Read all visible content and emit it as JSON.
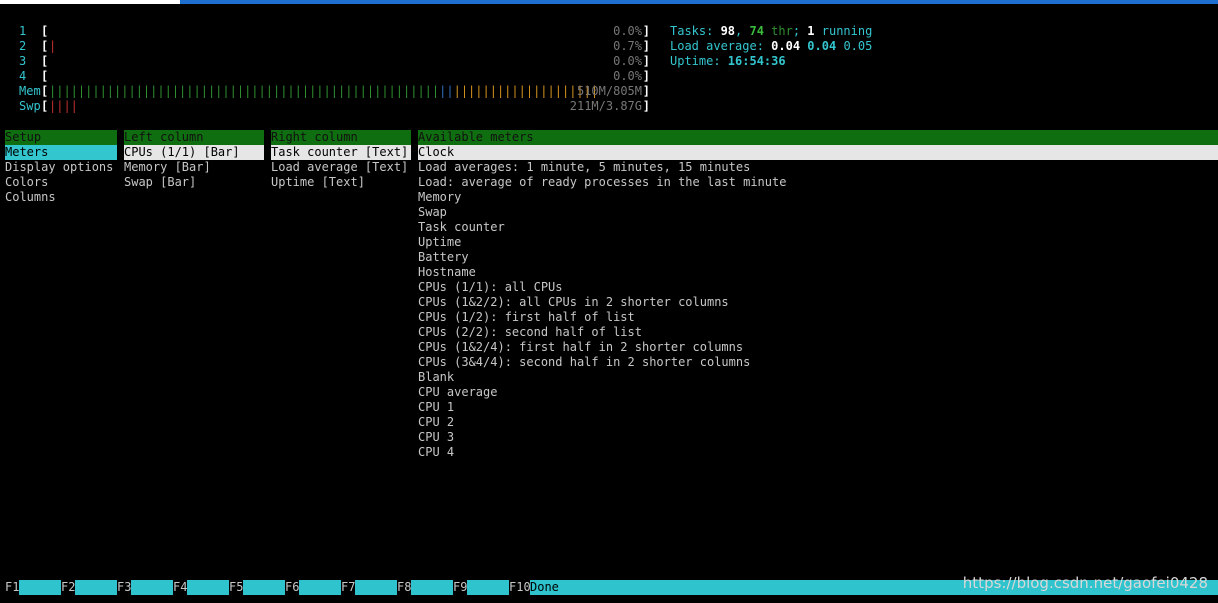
{
  "cpus": [
    {
      "num": "1",
      "bars": "",
      "value": "0.0%"
    },
    {
      "num": "2",
      "bars": "|",
      "value": "0.7%"
    },
    {
      "num": "3",
      "bars": "",
      "value": "0.0%"
    },
    {
      "num": "4",
      "bars": "",
      "value": "0.0%"
    }
  ],
  "mem": {
    "label": "Mem",
    "value": "510M/805M"
  },
  "swp": {
    "label": "Swp",
    "value": "211M/3.87G"
  },
  "tasks": {
    "label": "Tasks: ",
    "count": "98",
    "sep": ", ",
    "thr_count": "74",
    "thr": " thr",
    "sep2": "; ",
    "running_count": "1",
    "running": " running"
  },
  "load": {
    "label": "Load average: ",
    "l1": "0.04",
    "l5": "0.04",
    "l15": "0.05"
  },
  "uptime": {
    "label": "Uptime: ",
    "value": "16:54:36"
  },
  "setup": {
    "header": "Setup",
    "items": [
      "Meters",
      "Display options",
      "Colors",
      "Columns"
    ]
  },
  "left_column": {
    "header": "Left column",
    "items": [
      "CPUs (1/1) [Bar]",
      "Memory [Bar]",
      "Swap [Bar]"
    ]
  },
  "right_column": {
    "header": "Right column",
    "items": [
      "Task counter [Text]",
      "Load average [Text]",
      "Uptime [Text]"
    ]
  },
  "available": {
    "header": "Available meters",
    "items": [
      "Clock",
      "Load averages: 1 minute, 5 minutes, 15 minutes",
      "Load: average of ready processes in the last minute",
      "Memory",
      "Swap",
      "Task counter",
      "Uptime",
      "Battery",
      "Hostname",
      "CPUs (1/1): all CPUs",
      "CPUs (1&2/2): all CPUs in 2 shorter columns",
      "CPUs (1/2): first half of list",
      "CPUs (2/2): second half of list",
      "CPUs (1&2/4): first half in 2 shorter columns",
      "CPUs (3&4/4): second half in 2 shorter columns",
      "Blank",
      "CPU average",
      "CPU 1",
      "CPU 2",
      "CPU 3",
      "CPU 4"
    ]
  },
  "fkeys": [
    {
      "key": "F1",
      "label": ""
    },
    {
      "key": "F2",
      "label": ""
    },
    {
      "key": "F3",
      "label": ""
    },
    {
      "key": "F4",
      "label": ""
    },
    {
      "key": "F5",
      "label": ""
    },
    {
      "key": "F6",
      "label": ""
    },
    {
      "key": "F7",
      "label": ""
    },
    {
      "key": "F8",
      "label": ""
    },
    {
      "key": "F9",
      "label": ""
    },
    {
      "key": "F10",
      "label": "Done"
    }
  ],
  "watermark": "https://blog.csdn.net/gaofei0428",
  "colors": {
    "cyan": "#34c6cf",
    "header_green": "#0f6e0f",
    "selection_white": "#e6e6e6",
    "bar_red": "#c03030",
    "mem_green": "#2f8f2f",
    "mem_blue": "#3070c0",
    "mem_orange": "#d09020"
  }
}
